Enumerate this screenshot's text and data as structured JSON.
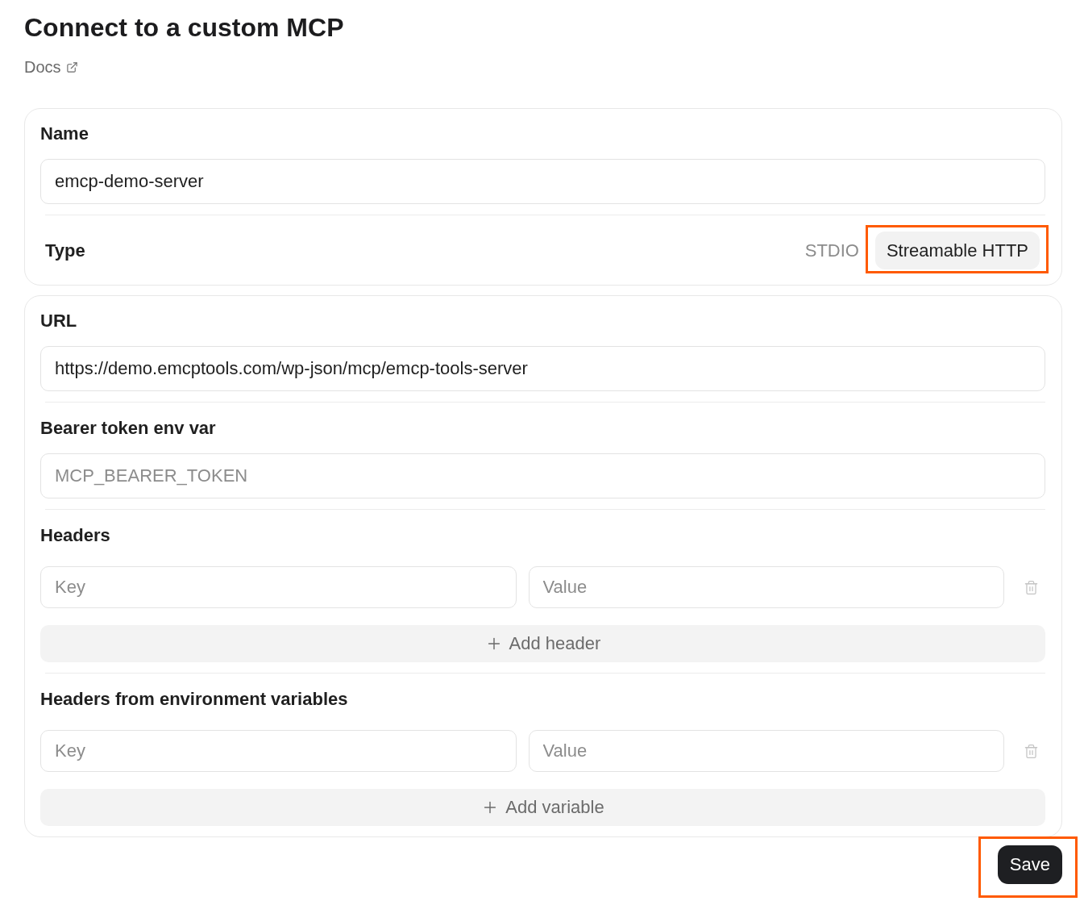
{
  "title": "Connect to a custom MCP",
  "docs_link": "Docs",
  "sections": [
    {
      "fields": [
        {
          "kind": "text",
          "label": "Name",
          "value": "emcp-demo-server"
        },
        {
          "kind": "choice",
          "label": "Type",
          "options": [
            {
              "label": "STDIO",
              "selected": false,
              "highlighted": false
            },
            {
              "label": "Streamable HTTP",
              "selected": true,
              "highlighted": true
            }
          ]
        }
      ]
    },
    {
      "fields": [
        {
          "kind": "text",
          "label": "URL",
          "value": "https://demo.emcptools.com/wp-json/mcp/emcp-tools-server"
        },
        {
          "kind": "text",
          "label": "Bearer token env var",
          "placeholder": "MCP_BEARER_TOKEN"
        },
        {
          "kind": "pairs",
          "label": "Headers",
          "rows": [
            {
              "key_placeholder": "Key",
              "value_placeholder": "Value"
            }
          ],
          "add_label": "Add header"
        },
        {
          "kind": "pairs",
          "label": "Headers from environment variables",
          "rows": [
            {
              "key_placeholder": "Key",
              "value_placeholder": "Value"
            }
          ],
          "add_label": "Add variable"
        }
      ]
    }
  ],
  "save_button": {
    "label": "Save",
    "highlighted": true
  }
}
